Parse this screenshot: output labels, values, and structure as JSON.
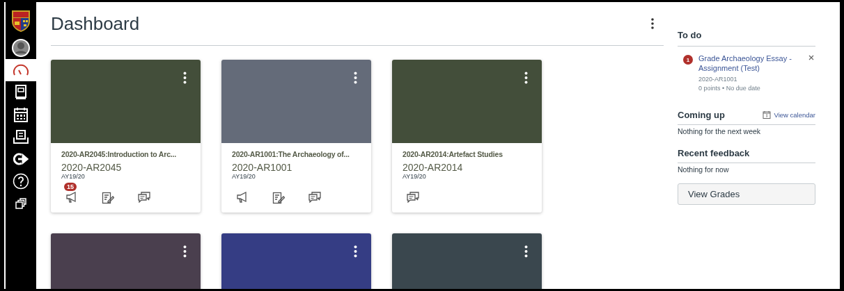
{
  "nav": [
    {
      "kind": "account",
      "selected": false
    },
    {
      "kind": "dashboard",
      "selected": true
    },
    {
      "kind": "courses",
      "selected": false
    },
    {
      "kind": "calendar",
      "selected": false
    },
    {
      "kind": "inbox",
      "selected": false
    },
    {
      "kind": "logout",
      "selected": false
    },
    {
      "kind": "help",
      "selected": false
    },
    {
      "kind": "commons",
      "selected": false
    }
  ],
  "title": "Dashboard",
  "cards": [
    {
      "color": "#434e3a",
      "title": "2020-AR2045:Introduction to Arc...",
      "code": "2020-AR2045",
      "term": "AY19/20",
      "actions": [
        {
          "kind": "announcements",
          "badge": "15"
        },
        {
          "kind": "assignments"
        },
        {
          "kind": "discussions"
        }
      ]
    },
    {
      "color": "#646b79",
      "title": "2020-AR1001:The Archaeology of...",
      "code": "2020-AR1001",
      "term": "AY19/20",
      "actions": [
        {
          "kind": "announcements"
        },
        {
          "kind": "assignments"
        },
        {
          "kind": "discussions"
        }
      ]
    },
    {
      "color": "#434e3a",
      "title": "2020-AR2014:Artefact Studies",
      "code": "2020-AR2014",
      "term": "AY19/20",
      "actions": [
        {
          "kind": "discussions"
        }
      ]
    },
    {
      "color": "#4a3f4e"
    },
    {
      "color": "#353d84"
    },
    {
      "color": "#3a474e"
    }
  ],
  "todo": {
    "heading": "To do",
    "items": [
      {
        "badge": "1",
        "title": "Grade Archaeology Essay - Assignment (Test)",
        "course": "2020-AR1001",
        "meta": "0 points • No due date"
      }
    ]
  },
  "coming_up": {
    "heading": "Coming up",
    "link": "View calendar",
    "empty": "Nothing for the next week"
  },
  "feedback": {
    "heading": "Recent feedback",
    "empty": "Nothing for now"
  },
  "grades_button": "View Grades"
}
